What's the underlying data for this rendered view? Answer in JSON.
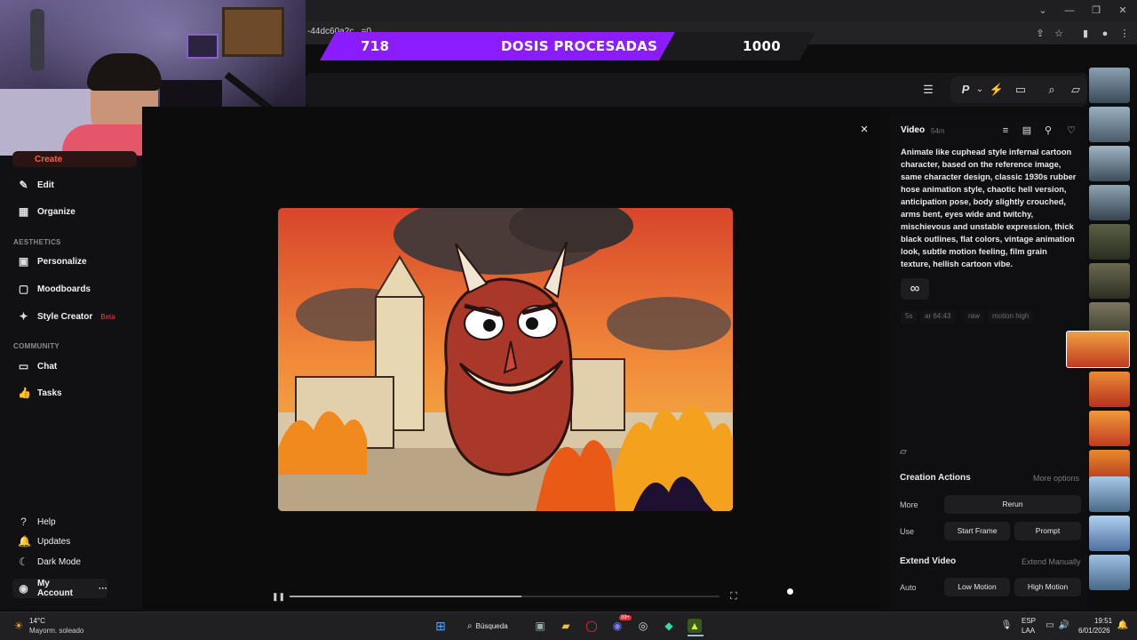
{
  "browser": {
    "url_fragment": "-44dc60a2c...=0",
    "controls": [
      "chevron-down",
      "minimize",
      "restore",
      "close"
    ]
  },
  "overlay": {
    "count_left": "718",
    "title": "DOSIS PROCESADAS",
    "count_right": "1000",
    "accent": "#8b1cff"
  },
  "header": {
    "icons": [
      "sliders-icon",
      "p-icon",
      "chevron-down-icon",
      "bolt-icon",
      "chat-icon",
      "search-icon",
      "folder-icon"
    ]
  },
  "sidebar": {
    "create": "Create",
    "edit": "Edit",
    "organize": "Organize",
    "aesthetics_heading": "AESTHETICS",
    "personalize": "Personalize",
    "moodboards": "Moodboards",
    "style_creator": "Style Creator",
    "beta": "Beta",
    "community_heading": "COMMUNITY",
    "chat": "Chat",
    "tasks": "Tasks",
    "help": "Help",
    "updates": "Updates",
    "dark_mode": "Dark Mode",
    "my_account": "My Account",
    "more": "···"
  },
  "viewer": {
    "close": "×",
    "progress": 0.54
  },
  "panel": {
    "title": "Video",
    "age": "54m",
    "prompt": "Animate like cuphead style infernal cartoon character, based on the reference image, same character design, classic 1930s rubber hose animation style, chaotic hell version, anticipation pose, body slightly crouched, arms bent, eyes wide and twitchy, mischievous and unstable expression, thick black outlines, flat colors, vintage animation look, subtle motion feeling, film grain texture, hellish cartoon vibe.",
    "loop": "∞",
    "params": [
      "5s",
      "ar 64:43",
      "raw",
      "motion high"
    ],
    "creation_actions": "Creation Actions",
    "more_options": "More options",
    "more_label": "More",
    "rerun": "Rerun",
    "use_label": "Use",
    "start_frame": "Start Frame",
    "prompt_btn": "Prompt",
    "extend_video": "Extend Video",
    "extend_manually": "Extend Manually",
    "auto_label": "Auto",
    "low_motion": "Low Motion",
    "high_motion": "High Motion"
  },
  "taskbar": {
    "weather_temp": "14°C",
    "weather_desc": "Mayorm. soleado",
    "search": "Búsqueda",
    "lang": "ESP",
    "lang_sub": "LAA",
    "time": "19:51",
    "date": "6/01/2026",
    "badge": "99+"
  }
}
